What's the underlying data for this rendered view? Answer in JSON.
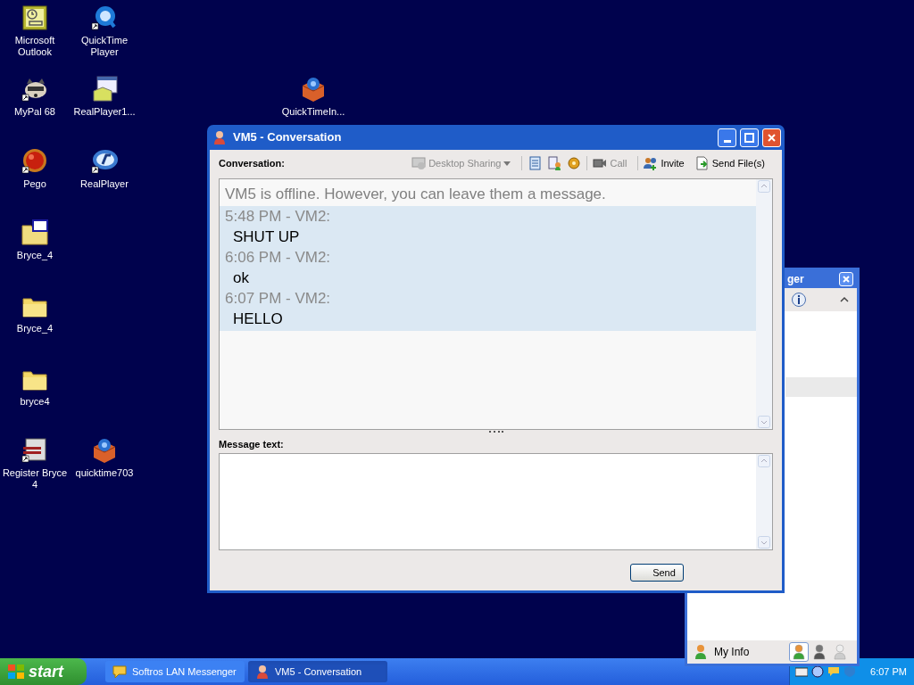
{
  "desktop_icons": [
    {
      "label": "Microsoft Outlook",
      "kind": "outlook"
    },
    {
      "label": "QuickTime Player",
      "kind": "quicktime"
    },
    {
      "label": "MyPal 68",
      "kind": "raccoon"
    },
    {
      "label": "RealPlayer1...",
      "kind": "installer"
    },
    {
      "label": "QuickTimeIn...",
      "kind": "package"
    },
    {
      "label": "Pego",
      "kind": "ball"
    },
    {
      "label": "RealPlayer",
      "kind": "realplayer"
    },
    {
      "label": "Bryce_4",
      "kind": "iso"
    },
    {
      "label": "Bryce_4",
      "kind": "folder"
    },
    {
      "label": "bryce4",
      "kind": "folder"
    },
    {
      "label": "Register Bryce 4",
      "kind": "register"
    },
    {
      "label": "quicktime703",
      "kind": "package"
    }
  ],
  "messenger": {
    "title": "ger",
    "my_info": "My Info",
    "statuses": [
      {
        "kind": "online",
        "selected": true
      },
      {
        "kind": "busy",
        "selected": false
      },
      {
        "kind": "offline",
        "selected": false
      }
    ]
  },
  "conversation": {
    "title": "VM5 - Conversation",
    "section_label": "Conversation:",
    "toolbar": [
      {
        "kind": "sharing",
        "label": "Desktop Sharing",
        "disabled": true
      },
      {
        "kind": "notes"
      },
      {
        "kind": "info"
      },
      {
        "kind": "gear"
      },
      {
        "kind": "call",
        "label": "Call",
        "disabled": true
      },
      {
        "kind": "invite",
        "label": "Invite",
        "disabled": false
      },
      {
        "kind": "file",
        "label": "Send File(s)",
        "disabled": false
      }
    ],
    "notice": "VM5 is offline. However, you can leave them a message.",
    "messages": [
      {
        "header": "5:48 PM - VM2:",
        "text": "SHUT UP"
      },
      {
        "header": "6:06 PM - VM2:",
        "text": "ok"
      },
      {
        "header": "6:07 PM - VM2:",
        "text": "HELLO"
      }
    ],
    "message_label": "Message text:",
    "send": "Send"
  },
  "taskbar": {
    "start": "start",
    "items": [
      {
        "label": "Softros LAN Messenger",
        "kind": "bubble",
        "selected": false
      },
      {
        "label": "VM5 - Conversation",
        "kind": "person",
        "selected": true
      }
    ],
    "clock": "6:07 PM"
  }
}
